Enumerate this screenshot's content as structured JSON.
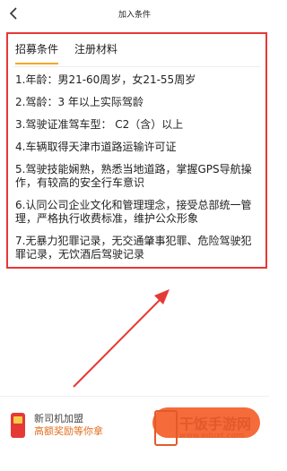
{
  "header": {
    "title": "加入条件"
  },
  "tabs": [
    {
      "label": "招募条件"
    },
    {
      "label": "注册材料"
    }
  ],
  "requirements": [
    "1.年龄：男21-60周岁，女21-55周岁",
    "2.驾龄：3 年以上实际驾龄",
    "3.驾驶证准驾车型： C2（含）以上",
    "4.车辆取得天津市道路运输许可证",
    "5.驾驶技能娴熟，熟悉当地道路，掌握GPS导航操作，有较高的安全行车意识",
    "6.认同公司企业文化和管理理念，接受总部统一管理，严格执行收费标准，维护公众形象",
    "7.无暴力犯罪记录，无交通肇事犯罪、危险驾驶犯罪记录，无饮酒后驾驶记录"
  ],
  "bottom": {
    "promo_title": "新司机加盟",
    "promo_subtitle": "高额奖励等你拿"
  },
  "watermark": {
    "text": "干饭手游网",
    "url": "www.eduxt.com"
  },
  "colors": {
    "highlight_box": "#e53935",
    "accent": "#f5a623",
    "promo_subtitle": "#e07020",
    "watermark": "#e35a2a"
  }
}
